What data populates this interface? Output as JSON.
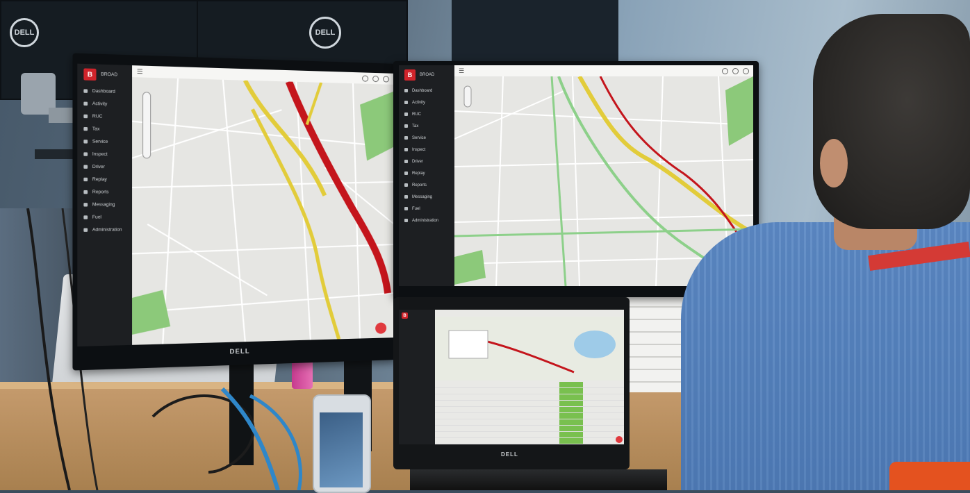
{
  "monitor_brand": "DELL",
  "laptop_brand": "DELL",
  "background_monitor_logo": "DELL",
  "app": {
    "logo": "B",
    "name": "BROAD",
    "menu_icon": "hamburger-icon",
    "fab_icon": "map-pin-icon"
  },
  "left_screen": {
    "sidebar_items": [
      "Dashboard",
      "Activity",
      "RUC",
      "Tax",
      "Service",
      "Inspect",
      "Driver",
      "Replay",
      "Reports",
      "Messaging",
      "Fuel",
      "Administration"
    ]
  },
  "right_screen": {
    "sidebar_items": [
      "Dashboard",
      "Activity",
      "RUC",
      "Tax",
      "Service",
      "Inspect",
      "Driver",
      "Replay",
      "Reports",
      "Messaging",
      "Fuel",
      "Administration"
    ]
  },
  "colors": {
    "brand_red": "#d0242b",
    "sidebar_bg": "#1d1f22",
    "map_bg": "#e9e9e6",
    "traffic_red": "#c4151c",
    "traffic_yellow": "#e2cc3a",
    "traffic_green": "#8dd08a",
    "park_green": "#8cc97a"
  }
}
